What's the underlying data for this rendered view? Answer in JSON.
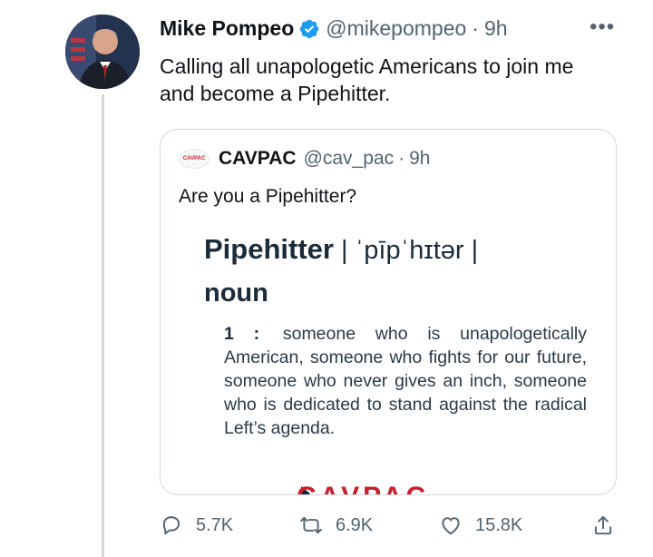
{
  "tweet": {
    "author_name": "Mike Pompeo",
    "handle": "@mikepompeo",
    "separator": "·",
    "time": "9h",
    "more": "•••",
    "text": "Calling all unapologetic Americans to join me and become a Pipehitter."
  },
  "quote": {
    "logo_text": "CAVPAC",
    "author_name": "CAVPAC",
    "handle": "@cav_pac",
    "separator": "·",
    "time": "9h",
    "text": "Are you a Pipehitter?",
    "image": {
      "word": "Pipehitter",
      "pronunciation": " | ˈpīpˈhɪtər | ",
      "part_of_speech": "noun",
      "definition_number": "1 :",
      "definition": "someone who is unapologetically American, someone who fights for our future, someone who never gives an inch, someone who is dedicated to stand against the radical Left’s agenda.",
      "banner_text": "CAVPAC"
    }
  },
  "actions": {
    "replies": "5.7K",
    "retweets": "6.9K",
    "likes": "15.8K"
  },
  "colors": {
    "text": "#0f1419",
    "secondary": "#536471",
    "verified": "#1d9bf0",
    "border": "#cfd9de",
    "brand_red": "#c8202d"
  }
}
